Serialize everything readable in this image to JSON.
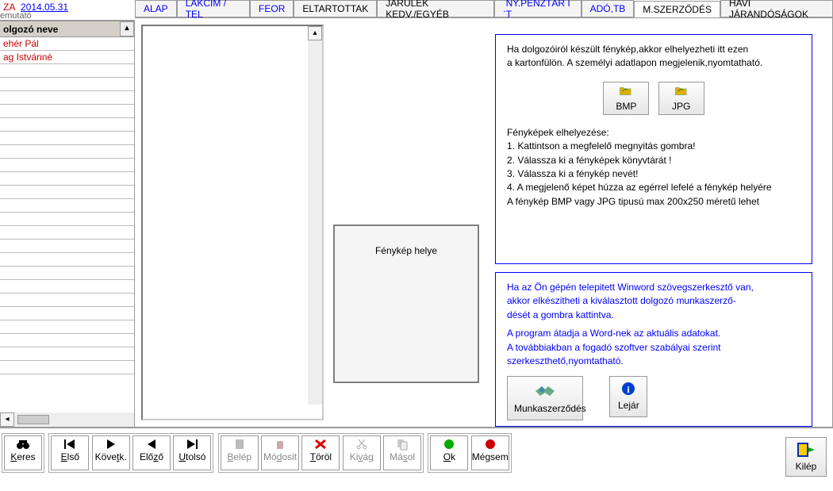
{
  "top": {
    "za": "ZA",
    "date": "2014.05.31",
    "emutato": "emutató"
  },
  "tabs": {
    "t0": "ALAP",
    "t1": "LAKCIM / TEL",
    "t2": "FEOR",
    "t3": "ELTARTOTTAK",
    "t4": "JÁRULÉK KEDV./EGYÉB",
    "t5": "NY.PÉNZTÁR I T",
    "t6": "ADÓ,TB",
    "t7": "M.SZERZŐDÉS",
    "t8": "HAVI JÁRANDÓSÁGOK"
  },
  "list": {
    "header": "olgozó neve",
    "rows": [
      "ehér Pál",
      "ag Istvánné",
      "",
      "",
      "",
      "",
      "",
      "",
      "",
      "",
      "",
      "",
      "",
      "",
      "",
      "",
      "",
      "",
      "",
      "",
      "",
      "",
      "",
      "",
      ""
    ]
  },
  "photo_placeholder": "Fénykép helye",
  "panel1": {
    "l1": "Ha dolgozóiról készült fénykép,akkor elhelyezheti itt ezen",
    "l2": "a kartonfülön. A személyi adatlapon megjelenik,nyomtatható.",
    "btn_bmp": "BMP",
    "btn_jpg": "JPG",
    "h": "Fényképek elhelyezése:",
    "s1": "1. Kattintson a  megfelelő megnyitás gombra!",
    "s2": "2. Válassza ki a fényképek könyvtárát !",
    "s3": "3. Válassza ki a fénykép nevét!",
    "s4": "4. A megjelenő képet húzza az egérrel lefelé a fénykép helyére",
    "s5": "A fénykép BMP vagy JPG tipusú max 200x250 méretű lehet"
  },
  "panel2": {
    "l1": "Ha az Ön gépén telepitett Winword szövegszerkesztő van,",
    "l2": "akkor elkészitheti a kiválasztott dolgozó munkaszerző-",
    "l3": "dését a gombra kattintva.",
    "l4": "A program átadja a  Word-nek az aktuális adatokat.",
    "l5": "A továbbiakban a fogadó szoftver szabályai szerint",
    "l6": "szerkeszthető,nyomtatható.",
    "btn_contract": "Munkaszerződés",
    "btn_expire": "Lejár"
  },
  "toolbar": {
    "keres": "Keres",
    "elso": "Első",
    "kovetk": "Követk.",
    "elozo": "Előző",
    "utolso": "Utolsó",
    "belep": "Belép",
    "modosit": "Módosit",
    "torol": "Töröl",
    "kivag": "Kivág",
    "masol": "Másol",
    "ok": "Ok",
    "megsem": "Mégsem",
    "kilep": "Kilép"
  }
}
